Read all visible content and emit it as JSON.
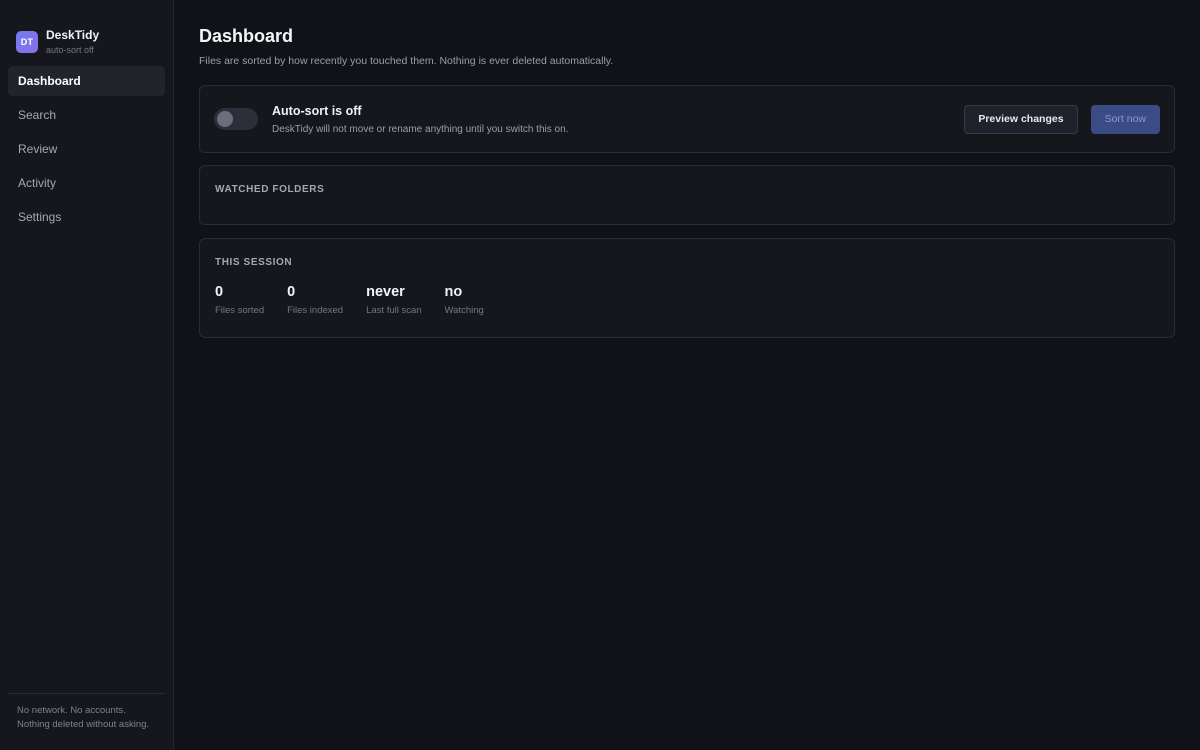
{
  "brand": {
    "logo_text": "DT",
    "name": "DeskTidy",
    "status": "auto-sort off",
    "accent": "#6f7cf2"
  },
  "nav": {
    "items": [
      {
        "label": "Dashboard",
        "active": true
      },
      {
        "label": "Search",
        "active": false
      },
      {
        "label": "Review",
        "active": false
      },
      {
        "label": "Activity",
        "active": false
      },
      {
        "label": "Settings",
        "active": false
      }
    ]
  },
  "footer": {
    "line1": "No network. No accounts.",
    "line2": "Nothing deleted without asking."
  },
  "page": {
    "title": "Dashboard",
    "subtitle": "Files are sorted by how recently you touched them. Nothing is ever deleted automatically."
  },
  "autosort": {
    "enabled": false,
    "title": "Auto-sort is off",
    "description": "DeskTidy will not move or rename anything until you switch this on.",
    "preview_label": "Preview changes",
    "sort_label": "Sort now"
  },
  "folders": {
    "heading": "WATCHED FOLDERS"
  },
  "session": {
    "heading": "THIS SESSION",
    "stats": [
      {
        "value": "0",
        "label": "Files sorted"
      },
      {
        "value": "0",
        "label": "Files indexed"
      },
      {
        "value": "never",
        "label": "Last full scan"
      },
      {
        "value": "no",
        "label": "Watching"
      }
    ]
  }
}
